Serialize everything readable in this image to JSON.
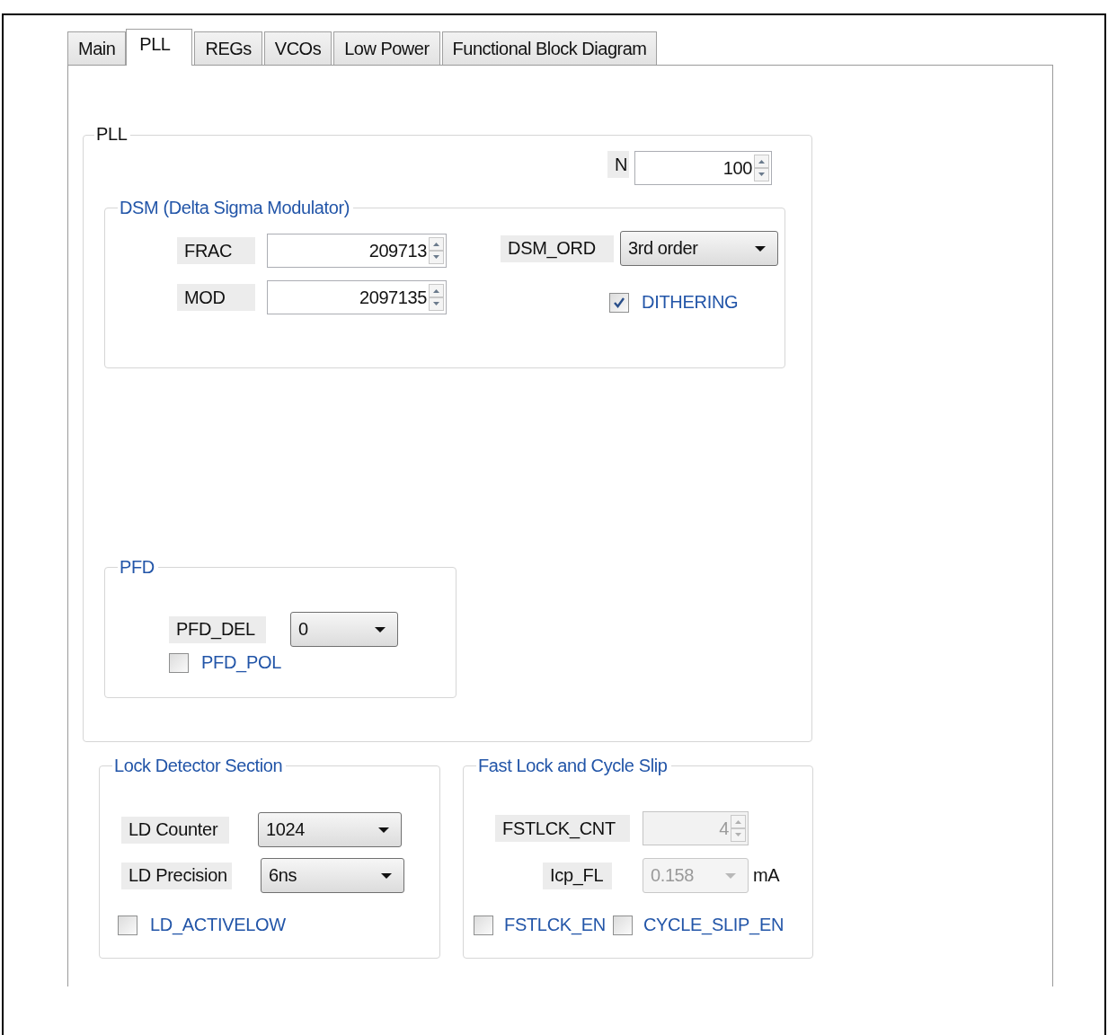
{
  "tabs": [
    {
      "label": "Main",
      "selected": false
    },
    {
      "label": "PLL",
      "selected": true
    },
    {
      "label": "REGs",
      "selected": false
    },
    {
      "label": "VCOs",
      "selected": false
    },
    {
      "label": "Low Power",
      "selected": false
    },
    {
      "label": "Functional Block Diagram",
      "selected": false
    }
  ],
  "pll": {
    "title": "PLL",
    "n": {
      "label": "N",
      "value": "100"
    },
    "dsm": {
      "title": "DSM (Delta Sigma Modulator)",
      "frac": {
        "label": "FRAC",
        "value": "209713"
      },
      "mod": {
        "label": "MOD",
        "value": "2097135"
      },
      "dsm_ord": {
        "label": "DSM_ORD",
        "value": "3rd order"
      },
      "dithering": {
        "label": "DITHERING",
        "checked": true
      }
    },
    "pfd": {
      "title": "PFD",
      "pfd_del": {
        "label": "PFD_DEL",
        "value": "0"
      },
      "pfd_pol": {
        "label": "PFD_POL",
        "checked": false
      }
    }
  },
  "lock_detector": {
    "title": "Lock Detector Section",
    "ld_counter": {
      "label": "LD Counter",
      "value": "1024"
    },
    "ld_precision": {
      "label": "LD Precision",
      "value": "6ns"
    },
    "ld_activelow": {
      "label": "LD_ACTIVELOW",
      "checked": false
    }
  },
  "fast_lock": {
    "title": "Fast Lock and Cycle Slip",
    "fstlck_cnt": {
      "label": "FSTLCK_CNT",
      "value": "4",
      "disabled": true
    },
    "icp_fl": {
      "label": "Icp_FL",
      "value": "0.158",
      "unit": "mA",
      "disabled": true
    },
    "fstlck_en": {
      "label": "FSTLCK_EN",
      "checked": false
    },
    "cycle_slip_en": {
      "label": "CYCLE_SLIP_EN",
      "checked": false
    }
  }
}
